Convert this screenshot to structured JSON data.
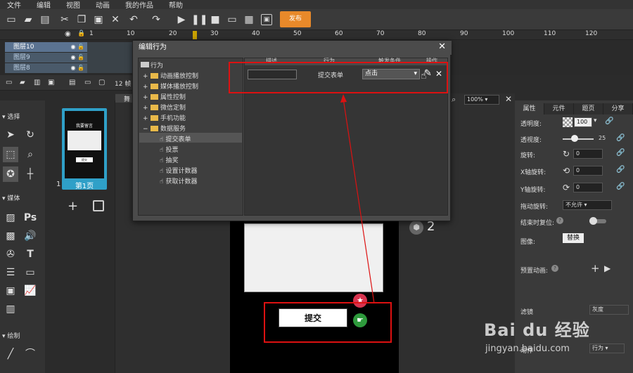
{
  "menu": [
    "文件",
    "编辑",
    "视图",
    "动画",
    "我的作品",
    "帮助"
  ],
  "toolbar": {
    "publish_label": "发布"
  },
  "ruler": [
    "1",
    "10",
    "20",
    "30",
    "40",
    "50",
    "60",
    "70",
    "80",
    "90",
    "100",
    "110",
    "120"
  ],
  "layers": [
    "图层10",
    "图层9",
    "图层8"
  ],
  "layer_footer": "12 帧",
  "left_panel": {
    "select_title": "选择",
    "media_title": "媒体",
    "draw_title": "绘制",
    "ps_label": "Ps",
    "text_tool": "T"
  },
  "pages": {
    "thumb_title": "我要留言",
    "thumb_btn": "提交",
    "page_number": "1",
    "page_label": "第1页"
  },
  "stage": {
    "zoom": "100%",
    "tab_partial": "舞",
    "counter": "2",
    "button_label": "提交"
  },
  "right_panel": {
    "tabs": [
      "属性",
      "元件",
      "题页",
      "分享"
    ],
    "opacity_label": "透明度:",
    "opacity_value": "100",
    "blur_label": "透视度:",
    "blur_value": "25",
    "rotate_label": "旋转:",
    "rotate_value": "0",
    "xrot_label": "X轴旋转:",
    "xrot_value": "0",
    "yrot_label": "Y轴旋转:",
    "yrot_value": "0",
    "drag_label": "拖动旋转:",
    "drag_value": "不允许",
    "reset_label": "结束时复位:",
    "image_label": "图像:",
    "replace_label": "替换",
    "preset_label": "预置动画:",
    "filter_label": "滤镜",
    "filter_value": "灰度",
    "action_label": "动作",
    "action_value": "行为"
  },
  "dialog": {
    "title": "编辑行为",
    "tree_root": "行为",
    "folders": [
      "动画播放控制",
      "媒体播放控制",
      "属性控制",
      "微信定制",
      "手机功能",
      "数据服务"
    ],
    "actions": [
      "提交表单",
      "投票",
      "抽奖",
      "设置计数器",
      "获取计数器"
    ],
    "table_headers": [
      "描述",
      "行为",
      "触发条件",
      "操作"
    ],
    "row_behavior": "提交表单",
    "row_trigger": "点击"
  },
  "watermark": {
    "text": "Bai du 经验",
    "url": "jingyan.baidu.com"
  },
  "colors": {
    "publish": "#e8892a",
    "annotation": "#dd1111",
    "page_thumb": "#2fa0c8",
    "folder": "#e9b949"
  }
}
